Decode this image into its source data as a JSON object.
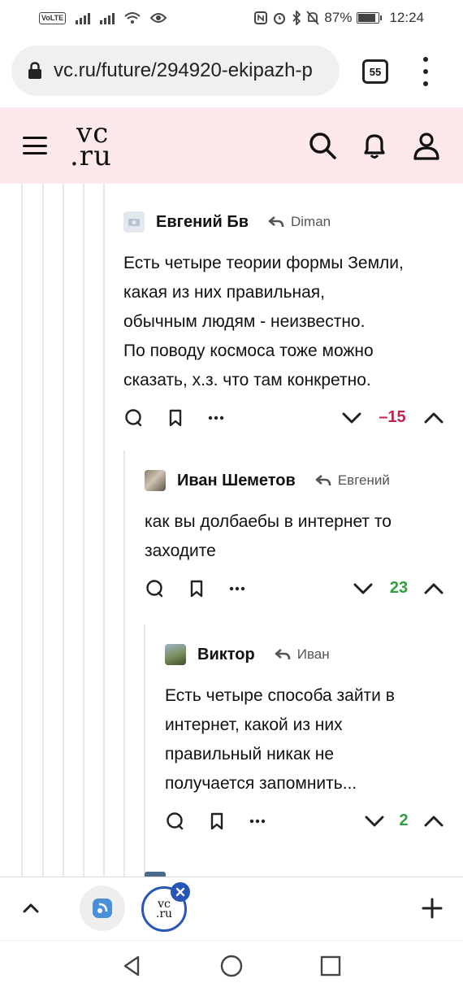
{
  "status_bar": {
    "volte": "VoLTE",
    "battery": "87%",
    "battery_level": 0.87,
    "time": "12:24"
  },
  "browser": {
    "url": "vc.ru/future/294920-ekipazh-p",
    "tab_count": "55"
  },
  "site": {
    "logo_line1": "vc",
    "logo_line2": ".ru",
    "header_bg": "#fde8ec"
  },
  "comments": [
    {
      "author": "Евгений Бв",
      "reply_to": "Diman",
      "text_lines": [
        "Есть четыре теории формы Земли,",
        "какая из них правильная,",
        "обычным людям - неизвестно.",
        "По поводу космоса тоже можно",
        "сказать, х.з. что там конкретно."
      ],
      "rating": "–15",
      "rating_color": "#c0244a"
    },
    {
      "author": "Иван Шеметов",
      "reply_to": "Евгений",
      "text_lines": [
        "как вы долбаебы в интернет то",
        "заходите"
      ],
      "rating": "23",
      "rating_color": "#2e9e3e"
    },
    {
      "author": "Виктор",
      "reply_to": "Иван",
      "text_lines": [
        "Есть четыре способа зайти в",
        "интернет, какой из них",
        "правильный никак не",
        "получается запомнить..."
      ],
      "rating": "2",
      "rating_color": "#2e9e3e"
    }
  ],
  "tab_strip": {
    "current_tab_logo_1": "vc",
    "current_tab_logo_2": ".ru",
    "accent": "#2855b8"
  }
}
